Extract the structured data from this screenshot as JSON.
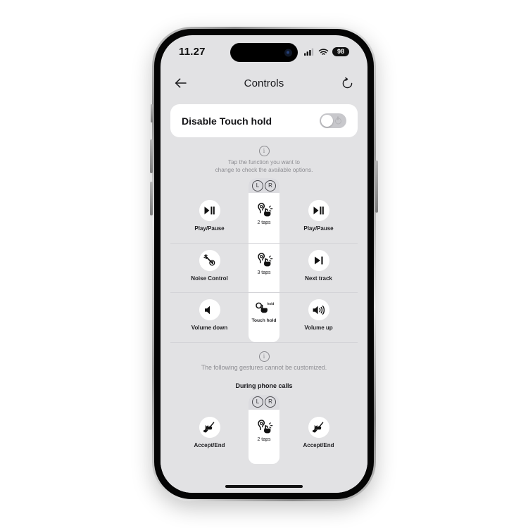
{
  "status_bar": {
    "time": "11.27",
    "cellular_icon": "signal-bars-icon",
    "wifi_icon": "wifi-icon",
    "battery_level": "98"
  },
  "nav": {
    "back_icon": "back-arrow-icon",
    "title": "Controls",
    "reset_icon": "reset-icon"
  },
  "toggle_card": {
    "label": "Disable Touch hold",
    "state": "off"
  },
  "info_primary": {
    "icon": "info-icon",
    "line1": "Tap the function you want to",
    "line2": "change to check the available options."
  },
  "gesture_table": {
    "left_badge": "L",
    "right_badge": "R",
    "rows": [
      {
        "gesture": "2 taps",
        "gesture_icon": "ear-two-taps-icon",
        "left_label": "Play/Pause",
        "left_icon": "play-pause-icon",
        "right_label": "Play/Pause",
        "right_icon": "play-pause-icon"
      },
      {
        "gesture": "3 taps",
        "gesture_icon": "ear-three-taps-icon",
        "left_label": "Noise Control",
        "left_icon": "noise-control-icon",
        "right_label": "Next track",
        "right_icon": "next-track-icon"
      },
      {
        "gesture": "Touch hold",
        "gesture_icon": "hand-touch-hold-icon",
        "left_label": "Volume down",
        "left_icon": "volume-down-icon",
        "right_label": "Volume up",
        "right_icon": "volume-up-icon"
      }
    ]
  },
  "info_secondary": {
    "icon": "info-icon",
    "text": "The following gestures cannot be customized."
  },
  "calls_section": {
    "heading": "During phone calls",
    "left_badge": "L",
    "right_badge": "R",
    "row": {
      "gesture": "2 taps",
      "gesture_icon": "ear-two-taps-icon",
      "left_label": "Accept/End",
      "left_icon": "call-accept-end-icon",
      "right_label": "Accept/End",
      "right_icon": "call-accept-end-icon"
    }
  },
  "colors": {
    "screen_bg": "#e2e2e4",
    "card_bg": "#ffffff",
    "text_primary": "#16161a",
    "text_muted": "#8d8d92",
    "divider": "#d4d4d8"
  }
}
